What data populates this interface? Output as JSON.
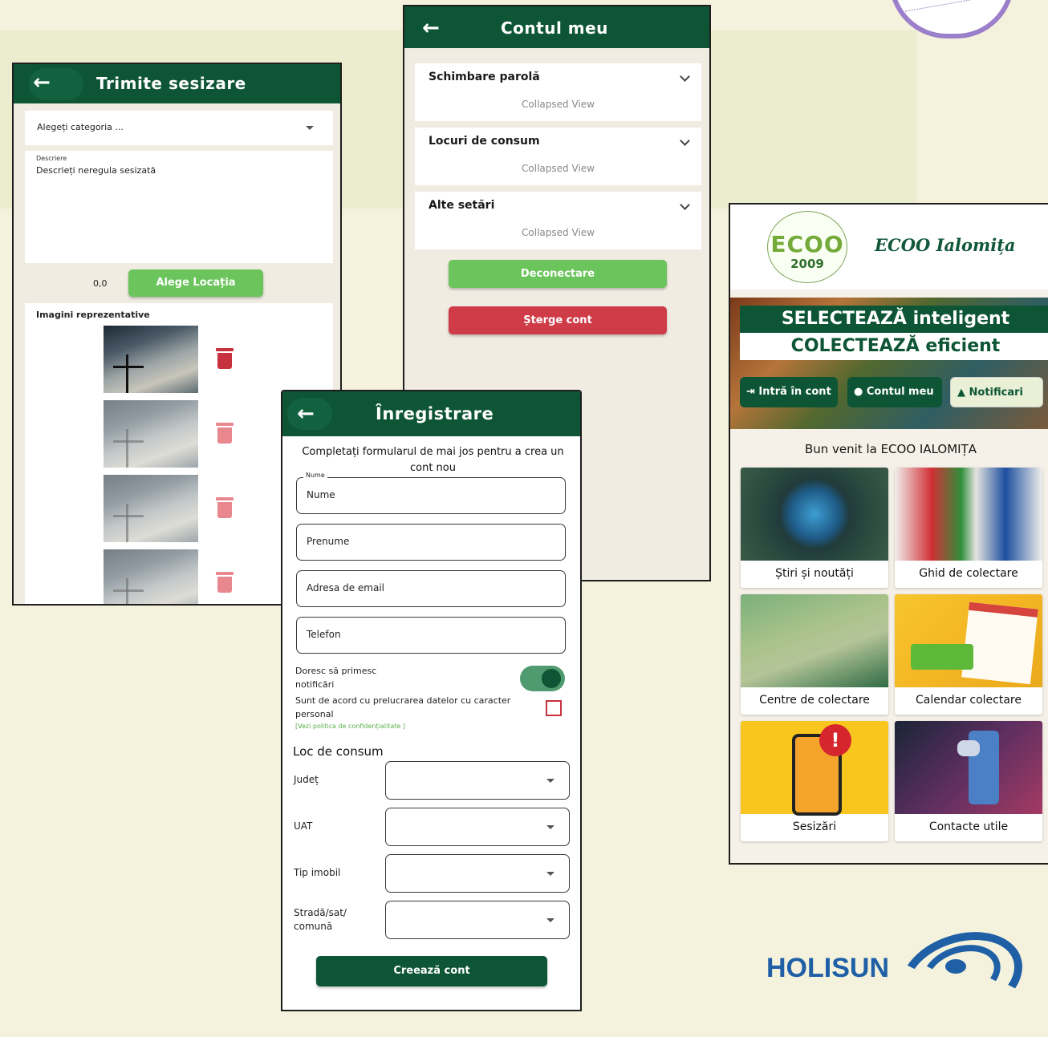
{
  "phone1": {
    "title": "Trimite sesizare",
    "category_placeholder": "Alegeți categoria ...",
    "description_label": "Descriere",
    "description_placeholder": "Descrieți neregula sesizată",
    "coords": "0,0",
    "choose_location": "Alege Locația",
    "images_label": "Imagini reprezentative"
  },
  "phone2": {
    "title": "Contul meu",
    "sections": [
      {
        "label": "Schimbare parolă",
        "body": "Collapsed View"
      },
      {
        "label": "Locuri de consum",
        "body": "Collapsed View"
      },
      {
        "label": "Alte setări",
        "body": "Collapsed View"
      }
    ],
    "logout": "Deconectare",
    "delete": "Șterge cont"
  },
  "phone3": {
    "title": "Înregistrare",
    "intro": "Completați formularul de mai jos pentru a crea un cont nou",
    "name_legend": "Nume",
    "fields": [
      "Nume",
      "Prenume",
      "Adresa de email",
      "Telefon"
    ],
    "notify_label": "Doresc să primesc notificări",
    "notify_on": true,
    "consent_label": "Sunt de acord cu prelucrarea datelor cu caracter personal",
    "privacy_link": "[Vezi politica de confidențialitate ]",
    "section_title": "Loc de consum",
    "selects": [
      "Județ",
      "UAT",
      "Tip imobil",
      "Stradă/sat/ comună"
    ],
    "submit": "Creează cont"
  },
  "phone4": {
    "logo_word": "ECOO",
    "logo_year": "2009",
    "brand": "ECOO Ialomița",
    "banner_line1": "SELECTEAZĂ inteligent",
    "banner_line2": "COLECTEAZĂ eficient",
    "login": "Intră în cont",
    "account": "Contul meu",
    "notifications": "Notificari",
    "welcome": "Bun venit la ECOO IALOMIȚA",
    "tiles": [
      "Știri și noutăți",
      "Ghid de colectare",
      "Centre de colectare",
      "Calendar colectare",
      "Sesizări",
      "Contacte utile"
    ]
  },
  "footer_logo": "HOLISUN",
  "colors": {
    "primary": "#0d5535",
    "green_button": "#6cc45d",
    "red_button": "#cf3b47",
    "toggle": "#4f9a6e"
  }
}
